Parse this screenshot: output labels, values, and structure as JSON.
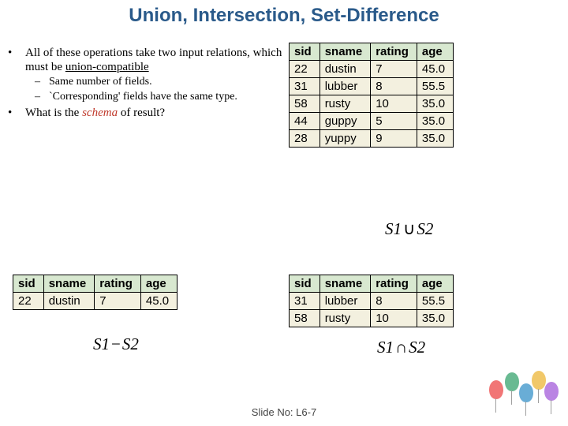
{
  "title": "Union, Intersection, Set-Difference",
  "bullets": {
    "b1a": "All of these operations take two input relations, which must be ",
    "b1u": "union-compatible",
    "s1": "Same number of fields.",
    "s2": "`Corresponding' fields have the same type.",
    "b2a": "What is the ",
    "b2s": "schema",
    "b2b": " of result?"
  },
  "headers": {
    "sid": "sid",
    "sname": "sname",
    "rating": "rating",
    "age": "age"
  },
  "big": [
    {
      "sid": "22",
      "sname": "dustin",
      "rating": "7",
      "age": "45.0"
    },
    {
      "sid": "31",
      "sname": "lubber",
      "rating": "8",
      "age": "55.5"
    },
    {
      "sid": "58",
      "sname": "rusty",
      "rating": "10",
      "age": "35.0"
    },
    {
      "sid": "44",
      "sname": "guppy",
      "rating": "5",
      "age": "35.0"
    },
    {
      "sid": "28",
      "sname": "yuppy",
      "rating": "9",
      "age": "35.0"
    }
  ],
  "minus": [
    {
      "sid": "22",
      "sname": "dustin",
      "rating": "7",
      "age": "45.0"
    }
  ],
  "inter": [
    {
      "sid": "31",
      "sname": "lubber",
      "rating": "8",
      "age": "55.5"
    },
    {
      "sid": "58",
      "sname": "rusty",
      "rating": "10",
      "age": "35.0"
    }
  ],
  "formulas": {
    "union_l": "S1",
    "union_op": "∪",
    "union_r": "S2",
    "minus_l": "S1",
    "minus_op": "−",
    "minus_r": "S2",
    "inter_l": "S1",
    "inter_op": "∩",
    "inter_r": "S2"
  },
  "footer": "Slide No: L6-7",
  "chart_data": [
    {
      "type": "table",
      "title": "S1 ∪ S2",
      "columns": [
        "sid",
        "sname",
        "rating",
        "age"
      ],
      "rows": [
        [
          22,
          "dustin",
          7,
          45.0
        ],
        [
          31,
          "lubber",
          8,
          55.5
        ],
        [
          58,
          "rusty",
          10,
          35.0
        ],
        [
          44,
          "guppy",
          5,
          35.0
        ],
        [
          28,
          "yuppy",
          9,
          35.0
        ]
      ]
    },
    {
      "type": "table",
      "title": "S1 − S2",
      "columns": [
        "sid",
        "sname",
        "rating",
        "age"
      ],
      "rows": [
        [
          22,
          "dustin",
          7,
          45.0
        ]
      ]
    },
    {
      "type": "table",
      "title": "S1 ∩ S2",
      "columns": [
        "sid",
        "sname",
        "rating",
        "age"
      ],
      "rows": [
        [
          31,
          "lubber",
          8,
          55.5
        ],
        [
          58,
          "rusty",
          10,
          35.0
        ]
      ]
    }
  ]
}
